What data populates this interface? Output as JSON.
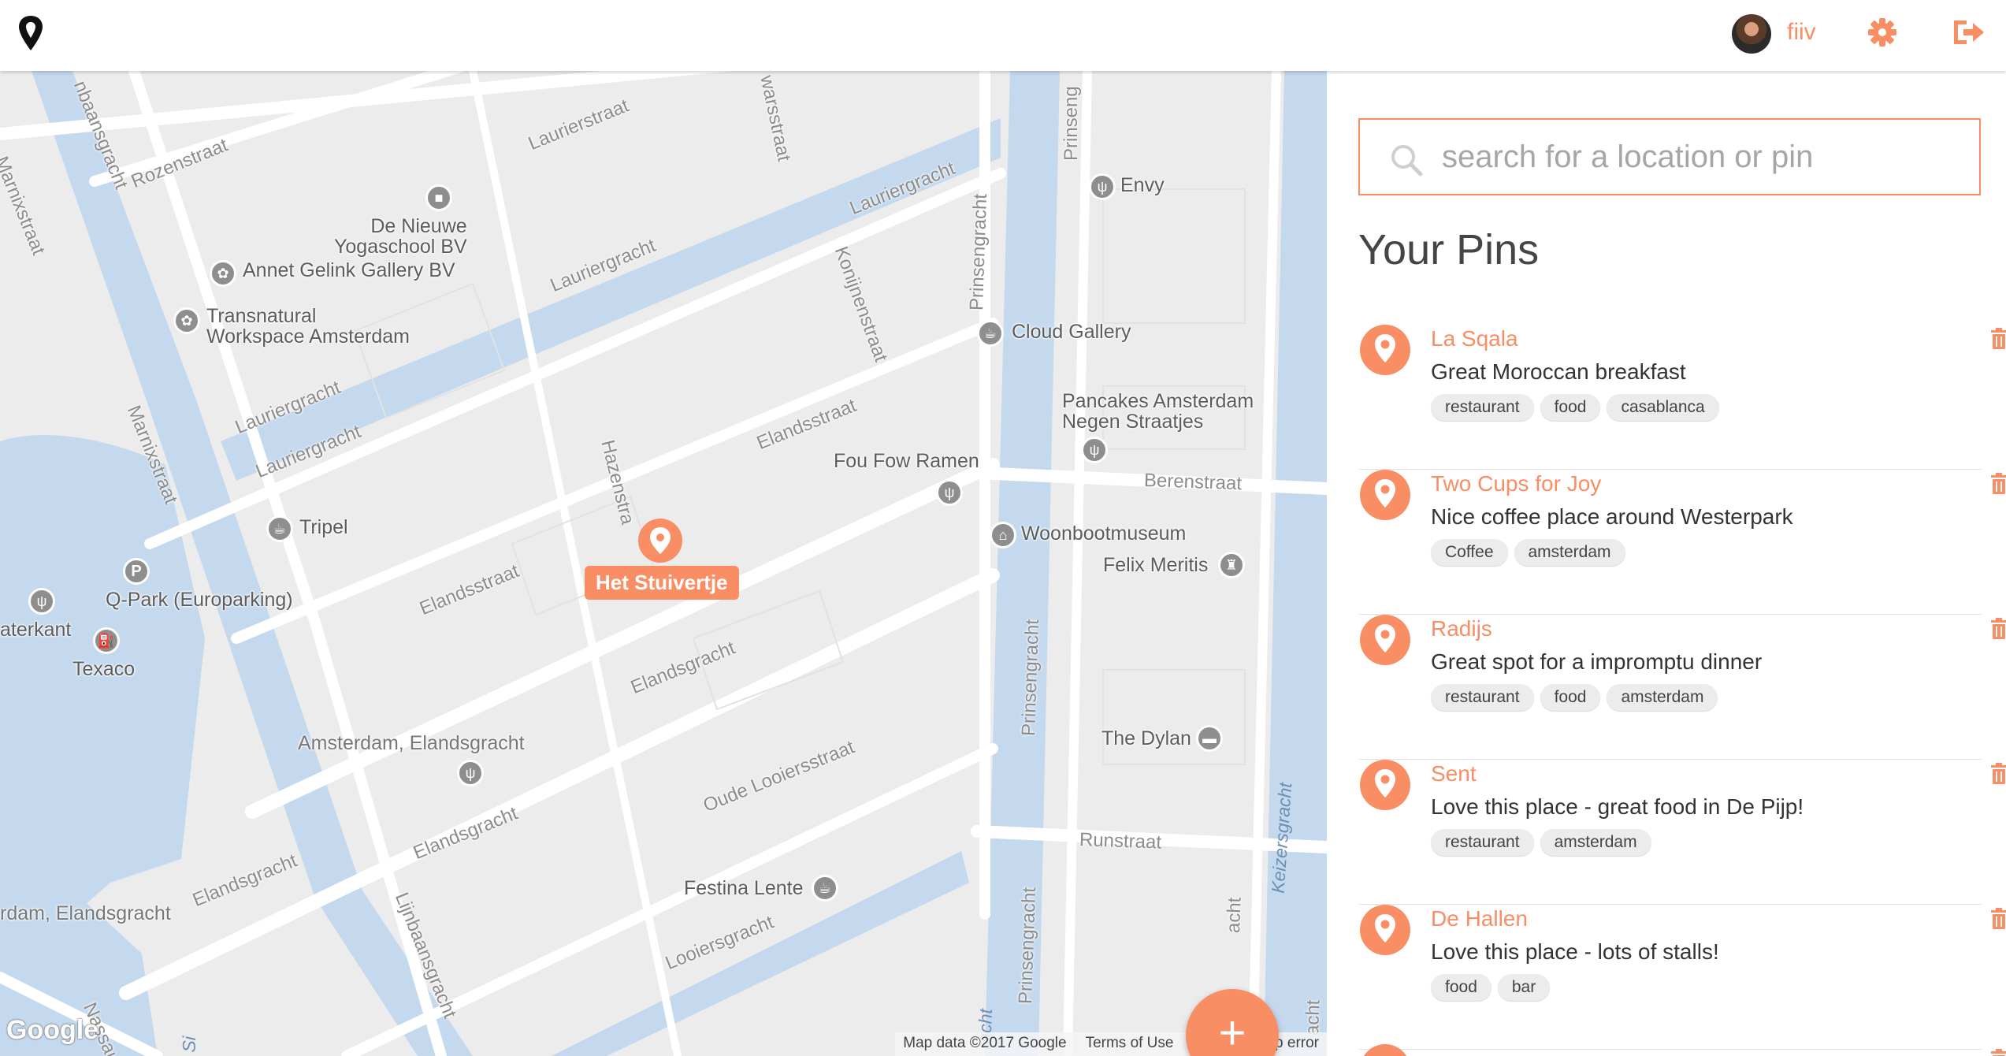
{
  "colors": {
    "accent": "#f98d64",
    "water": "#c4d8ee",
    "road": "#ffffff",
    "map_bg": "#efefef"
  },
  "header": {
    "logo_icon": "map-pin-logo-icon",
    "username": "fiiv",
    "settings_icon": "gear-icon",
    "logout_icon": "logout-icon"
  },
  "map": {
    "selected_pin": {
      "label": "Het Stuivertje"
    },
    "places": [
      {
        "name": "De Nieuwe\nYogaschool BV",
        "icon": "square-icon"
      },
      {
        "name": "Annet Gelink Gallery BV",
        "icon": "palette-icon"
      },
      {
        "name": "Transnatural\nWorkspace Amsterdam",
        "icon": "palette-icon"
      },
      {
        "name": "Envy",
        "icon": "restaurant-icon"
      },
      {
        "name": "Cloud Gallery",
        "icon": "cafe-icon"
      },
      {
        "name": "Pancakes Amsterdam\nNegen Straatjes",
        "icon": "restaurant-icon"
      },
      {
        "name": "Fou Fow Ramen",
        "icon": "restaurant-icon"
      },
      {
        "name": "Woonbootmuseum",
        "icon": "museum-icon"
      },
      {
        "name": "Felix Meritis",
        "icon": "landmark-icon"
      },
      {
        "name": "Tripel",
        "icon": "cafe-icon"
      },
      {
        "name": "Q-Park (Europarking)",
        "icon": "parking-icon"
      },
      {
        "name": "aterkant",
        "icon": "restaurant-icon"
      },
      {
        "name": "Texaco",
        "icon": "fuel-icon"
      },
      {
        "name": "Amsterdam, Elandsgracht",
        "icon": "tram-icon"
      },
      {
        "name": "The Dylan",
        "icon": "hotel-icon"
      },
      {
        "name": "Festina Lente",
        "icon": "cafe-icon"
      },
      {
        "name": "rdam, Elandsgracht",
        "icon": "tram-icon"
      }
    ],
    "streets": {
      "rozenstraat": "Rozenstraat",
      "lijnbaansgracht_top": "nbaansgracht",
      "lauriergracht_a": "Laurierstraat",
      "wars": "warsstraat",
      "prinseng_top": "Prinseng",
      "marnix_left": "Marnixstraat",
      "marnix_mid": "Marnixstraat",
      "lauriergracht_1": "Lauriergracht",
      "lauriergracht_2": "Lauriergracht",
      "lauriergracht_3": "Lauriergracht",
      "lauriergracht_4": "Lauriergracht",
      "konijnenstraat": "Konijnenstraat",
      "prinsengracht_a": "Prinsengracht",
      "elandsstraat_1": "Elandsstraat",
      "elandsstraat_2": "Elandsstraat",
      "hazenstraat": "Hazenstra",
      "berenstraat": "Berenstraat",
      "elandsgracht_1": "Elandsgracht",
      "elandsgracht_2": "Elandsgracht",
      "elandsgracht_3": "Elandsgracht",
      "prinsengracht_b": "Prinsengracht",
      "oude_looiersstraat": "Oude Looiersstraat",
      "runstraat": "Runstraat",
      "prinsengracht_c": "Prinsengracht",
      "looiersgracht": "Looiersgracht",
      "lijnbaansgracht_bottom": "Lijnbaansgracht",
      "nassau": "Nassau",
      "acht_1": "acht",
      "acht_2": "acht"
    },
    "canals": {
      "keizersgracht": "Keizersgracht",
      "acht": "acht",
      "si": "Si"
    },
    "google_logo": "Google",
    "attribution": {
      "map_data": "Map data ©2017 Google",
      "terms": "Terms of Use",
      "report": "Report a map error"
    },
    "add_button_label": "+"
  },
  "sidebar": {
    "search": {
      "placeholder": "search for a location or pin",
      "value": ""
    },
    "title": "Your Pins",
    "pins": [
      {
        "title": "La Sqala",
        "description": "Great Moroccan breakfast",
        "tags": [
          "restaurant",
          "food",
          "casablanca"
        ]
      },
      {
        "title": "Two Cups for Joy",
        "description": "Nice coffee place around Westerpark",
        "tags": [
          "Coffee",
          "amsterdam"
        ]
      },
      {
        "title": "Radijs",
        "description": "Great spot for a impromptu dinner",
        "tags": [
          "restaurant",
          "food",
          "amsterdam"
        ]
      },
      {
        "title": "Sent",
        "description": "Love this place - great food in De Pijp!",
        "tags": [
          "restaurant",
          "amsterdam"
        ]
      },
      {
        "title": "De Hallen",
        "description": "Love this place - lots of stalls!",
        "tags": [
          "food",
          "bar"
        ]
      }
    ]
  }
}
